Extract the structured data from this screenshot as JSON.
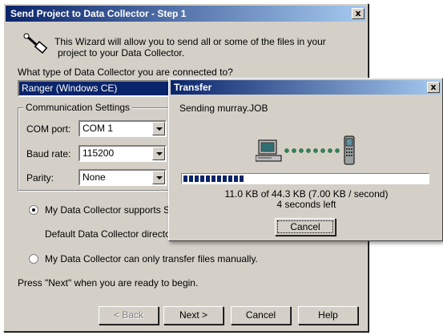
{
  "wizard": {
    "title": "Send Project to Data Collector - Step 1",
    "close_glyph": "x",
    "intro_line1": "This Wizard will allow you to send all or some of the files in your",
    "intro_line2": "project to your Data Collector.",
    "question": "What type of Data Collector you are connected to?",
    "collector_type": "Ranger (Windows CE)",
    "comm_group": "Communication Settings",
    "com_port_label": "COM port:",
    "com_port_value": "COM 1",
    "baud_label": "Baud rate:",
    "baud_value": "115200",
    "parity_label": "Parity:",
    "parity_value": "None",
    "radio1_label": "My Data Collector supports Serv",
    "default_dir_label": "Default Data Collector directory:",
    "radio2_label": "My Data Collector can only transfer files manually.",
    "instruction": "Press \"Next\" when you are ready to begin.",
    "back_button": "< Back",
    "next_button": "Next >",
    "cancel_button": "Cancel",
    "help_button": "Help"
  },
  "transfer": {
    "title": "Transfer",
    "close_glyph": "x",
    "status": "Sending murray.JOB",
    "progress_text": "11.0 KB of 44.3 KB (7.00 KB / second)",
    "time_left": "4 seconds left",
    "cancel_button": "Cancel",
    "progress_fraction": 0.25
  },
  "icons": [
    "wand-icon",
    "computer-icon",
    "data-collector-icon"
  ]
}
